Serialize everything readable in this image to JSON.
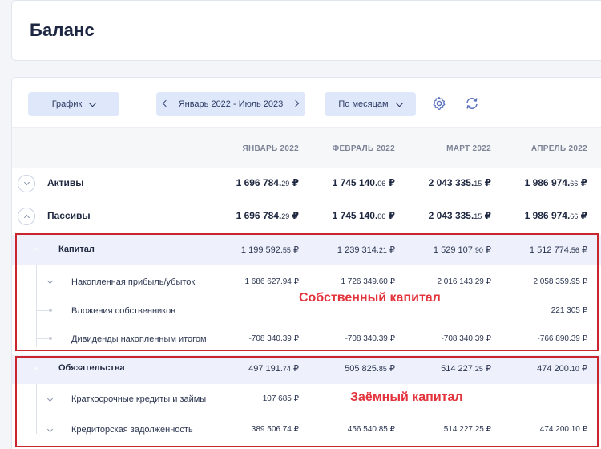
{
  "page": {
    "title": "Баланс"
  },
  "toolbar": {
    "chart_label": "График",
    "period_label": "Январь 2022 - Июль 2023",
    "group_label": "По месяцам",
    "icons": {
      "settings": "gear-icon",
      "refresh": "refresh-icon"
    }
  },
  "columns": [
    "ЯНВАРЬ 2022",
    "ФЕВРАЛЬ 2022",
    "МАРТ 2022",
    "АПРЕЛЬ 2022"
  ],
  "rows": [
    {
      "label": "Активы",
      "values": [
        [
          "1 696 784.",
          "29",
          " ₽"
        ],
        [
          "1 745 140.",
          "06",
          " ₽"
        ],
        [
          "2 043 335.",
          "15",
          " ₽"
        ],
        [
          "1 986 974.",
          "66",
          " ₽"
        ]
      ]
    },
    {
      "label": "Пассивы",
      "values": [
        [
          "1 696 784.",
          "29",
          " ₽"
        ],
        [
          "1 745 140.",
          "06",
          " ₽"
        ],
        [
          "2 043 335.",
          "15",
          " ₽"
        ],
        [
          "1 986 974.",
          "66",
          " ₽"
        ]
      ]
    },
    {
      "label": "Капитал",
      "values": [
        [
          "1 199 592.",
          "55",
          " ₽"
        ],
        [
          "1 239 314.",
          "21",
          " ₽"
        ],
        [
          "1 529 107.",
          "90",
          " ₽"
        ],
        [
          "1 512 774.",
          "56",
          " ₽"
        ]
      ]
    },
    {
      "label": "Накопленная прибыль/убыток",
      "values": [
        [
          "1 686 627.",
          "94",
          " ₽"
        ],
        [
          "1 726 349.",
          "60",
          " ₽"
        ],
        [
          "2 016 143.",
          "29",
          " ₽"
        ],
        [
          "2 058 359.",
          "95",
          " ₽"
        ]
      ]
    },
    {
      "label": "Вложения собственников",
      "values": [
        [
          "",
          "",
          ""
        ],
        [
          "",
          "",
          ""
        ],
        [
          "",
          "",
          ""
        ],
        [
          "221 305",
          "",
          " ₽"
        ]
      ]
    },
    {
      "label": "Дивиденды накопленным итогом",
      "values": [
        [
          "-708 340.",
          "39",
          " ₽"
        ],
        [
          "-708 340.",
          "39",
          " ₽"
        ],
        [
          "-708 340.",
          "39",
          " ₽"
        ],
        [
          "-766 890.",
          "39",
          " ₽"
        ]
      ]
    },
    {
      "label": "Обязательства",
      "values": [
        [
          "497 191.",
          "74",
          " ₽"
        ],
        [
          "505 825.",
          "85",
          " ₽"
        ],
        [
          "514 227.",
          "25",
          " ₽"
        ],
        [
          "474 200.",
          "10",
          " ₽"
        ]
      ]
    },
    {
      "label": "Краткосрочные кредиты и займы",
      "values": [
        [
          "107 685",
          "",
          " ₽"
        ],
        [
          "",
          "",
          ""
        ],
        [
          "",
          "",
          ""
        ],
        [
          "",
          "",
          ""
        ]
      ]
    },
    {
      "label": "Кредиторская задолженность",
      "values": [
        [
          "389 506.",
          "74",
          " ₽"
        ],
        [
          "456 540.",
          "85",
          " ₽"
        ],
        [
          "514 227.",
          "25",
          " ₽"
        ],
        [
          "474 200.",
          "10",
          " ₽"
        ]
      ]
    }
  ],
  "annotations": {
    "equity": "Собственный капитал",
    "debt": "Заёмный капитал",
    "color": "#e3343d"
  },
  "colors": {
    "accent": "#4c6ed4",
    "button_bg": "#dfe7fb",
    "highlight_row": "#eef1fb"
  }
}
